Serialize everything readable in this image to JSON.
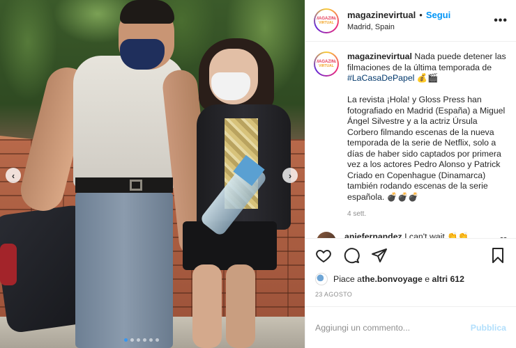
{
  "post": {
    "username": "magazinevirtual",
    "follow_label": "Segui",
    "separator": "•",
    "location": "Madrid, Spain",
    "more_label": "•••",
    "avatar_logo": {
      "line1": "MAGAZINE",
      "line2": "VIRTUAL"
    }
  },
  "caption": {
    "username": "magazinevirtual",
    "text_1": " Nada puede detener las filmaciones de la última temporada de ",
    "hashtag": "#LaCasaDePapel",
    "text_2": " 💰🎬\n\nLa revista ¡Hola! y Gloss Press han fotografiado en Madrid (España) a Miguel Ángel Silvestre y a la actriz Úrsula Corbero filmando escenas de la nueva temporada de la serie de Netflix, solo a días de haber sido captados por primera vez a los actores Pedro Alonso y Patrick Criado en Copenhague (Dinamarca) también rodando escenas de la serie española. 💣💣💣",
    "time": "4 sett."
  },
  "comments": [
    {
      "username": "aniefernandez",
      "text": " I can't wait 👏👏"
    }
  ],
  "actions": {
    "like_icon": "heart-icon",
    "comment_icon": "comment-icon",
    "share_icon": "paper-plane-icon",
    "save_icon": "bookmark-icon"
  },
  "likes": {
    "prefix": "Piace a ",
    "user": "the.bonvoyage",
    "middle": " e ",
    "others": "altri 612"
  },
  "date": "23 AGOSTO",
  "add_comment": {
    "placeholder": "Aggiungi un commento...",
    "publish_label": "Pubblica"
  },
  "carousel": {
    "prev": "‹",
    "next": "›",
    "total_slides": 6,
    "active_slide": 1
  },
  "colors": {
    "link": "#0095f6",
    "hashtag": "#00376b",
    "publish": "#b2dffc",
    "muted": "#8e8e8e"
  }
}
